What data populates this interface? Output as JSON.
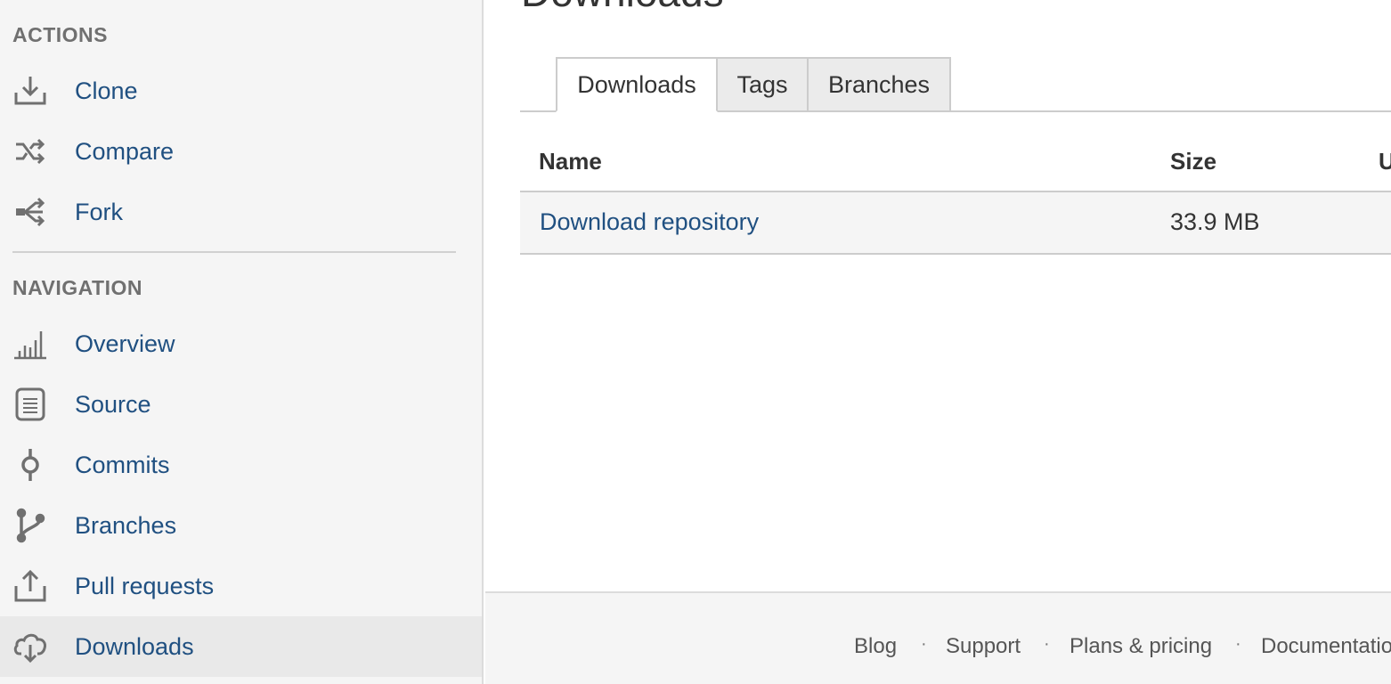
{
  "sidebar": {
    "actions_title": "ACTIONS",
    "navigation_title": "NAVIGATION",
    "actions": [
      {
        "label": "Clone",
        "icon": "clone-icon"
      },
      {
        "label": "Compare",
        "icon": "compare-icon"
      },
      {
        "label": "Fork",
        "icon": "fork-icon"
      }
    ],
    "navigation": [
      {
        "label": "Overview",
        "icon": "overview-icon"
      },
      {
        "label": "Source",
        "icon": "source-icon"
      },
      {
        "label": "Commits",
        "icon": "commits-icon"
      },
      {
        "label": "Branches",
        "icon": "branches-icon"
      },
      {
        "label": "Pull requests",
        "icon": "pull-requests-icon"
      },
      {
        "label": "Downloads",
        "icon": "downloads-icon",
        "active": true
      }
    ]
  },
  "main": {
    "title": "Downloads",
    "tabs": [
      {
        "label": "Downloads",
        "active": true
      },
      {
        "label": "Tags"
      },
      {
        "label": "Branches"
      }
    ],
    "table": {
      "columns": [
        "Name",
        "Size",
        "U"
      ],
      "rows": [
        {
          "name": "Download repository",
          "size": "33.9 MB"
        }
      ]
    }
  },
  "footer": {
    "links": [
      "Blog",
      "Support",
      "Plans & pricing",
      "Documentation"
    ],
    "separator": "·"
  },
  "colors": {
    "link": "#205081",
    "sidebar_bg": "#f5f5f5",
    "active_bg": "#e9e9e9"
  }
}
